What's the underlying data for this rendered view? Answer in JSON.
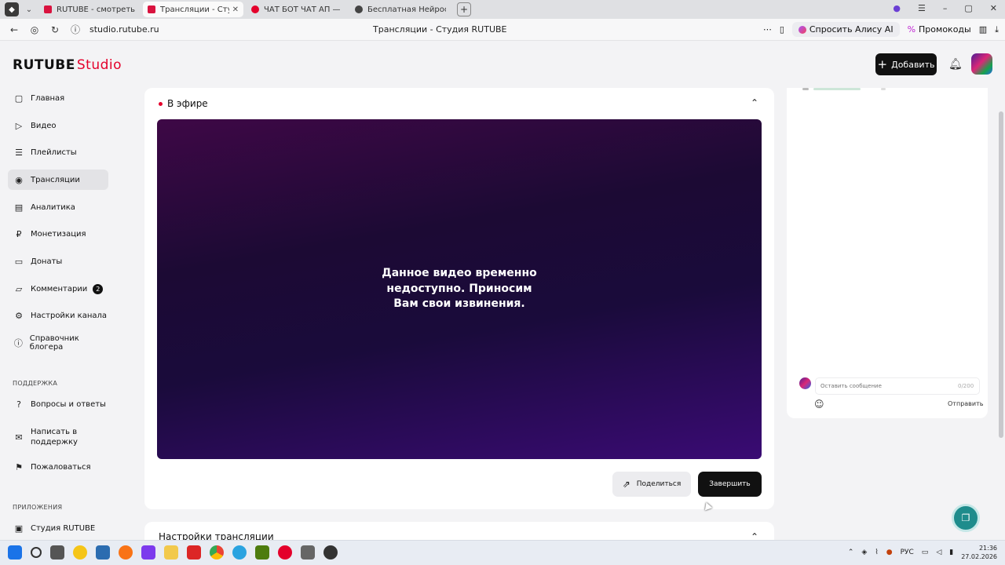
{
  "browser": {
    "tabs": [
      {
        "label": "RUTUBE - смотреть видео",
        "fav_color": "#d9133f",
        "active": false
      },
      {
        "label": "Трансляции - Студия RUTUBE",
        "fav_color": "#d9133f",
        "active": true
      },
      {
        "label": "ЧАТ БОТ ЧАТ АП — Яндекс",
        "fav_color": "#e4002b",
        "active": false
      },
      {
        "label": "Бесплатная Нейросеть: И",
        "fav_color": "#444444",
        "active": false
      }
    ],
    "url": "studio.rutube.ru",
    "page_title": "Трансляции - Студия RUTUBE",
    "alisa_label": "Спросить Алису AI",
    "promo_label": "Промокоды"
  },
  "header": {
    "logo_main": "RUTUBE",
    "logo_sub": "Studio",
    "add_label": "Добавить"
  },
  "sidebar": {
    "items": [
      {
        "label": "Главная",
        "icon": "▢"
      },
      {
        "label": "Видео",
        "icon": "▷"
      },
      {
        "label": "Плейлисты",
        "icon": "☰"
      },
      {
        "label": "Трансляции",
        "icon": "◉"
      },
      {
        "label": "Аналитика",
        "icon": "▤"
      },
      {
        "label": "Монетизация",
        "icon": "₽"
      },
      {
        "label": "Донаты",
        "icon": "▭"
      },
      {
        "label": "Комментарии",
        "icon": "▱",
        "badge": "2"
      },
      {
        "label": "Настройки канала",
        "icon": "⚙"
      },
      {
        "label": "Справочник блогера",
        "icon": "ⓘ"
      }
    ],
    "support_section": "ПОДДЕРЖКА",
    "support_items": [
      {
        "label": "Вопросы и ответы",
        "icon": "?"
      },
      {
        "label": "Написать в поддержку",
        "icon": "✉"
      },
      {
        "label": "Пожаловаться",
        "icon": "⚑"
      }
    ],
    "apps_section": "ПРИЛОЖЕНИЯ",
    "apps_items": [
      {
        "label": "Студия RUTUBE",
        "icon": "▣"
      }
    ]
  },
  "main": {
    "live_label": "В эфире",
    "player_message": "Данное видео временно недоступно. Приносим Вам свои извинения.",
    "share_label": "Поделиться",
    "finish_label": "Завершить",
    "settings_label": "Настройки трансляции"
  },
  "chat": {
    "placeholder": "Оставить сообщение",
    "counter": "0/200",
    "send_label": "Отправить"
  },
  "taskbar": {
    "lang": "РУС",
    "time": "21:36",
    "date": "27.02.2026"
  },
  "colors": {
    "accent": "#e4002b",
    "dark_button": "#111111",
    "player_top": "#3e0846",
    "player_bottom": "#3a0b74",
    "fab": "#1e8c8c"
  }
}
